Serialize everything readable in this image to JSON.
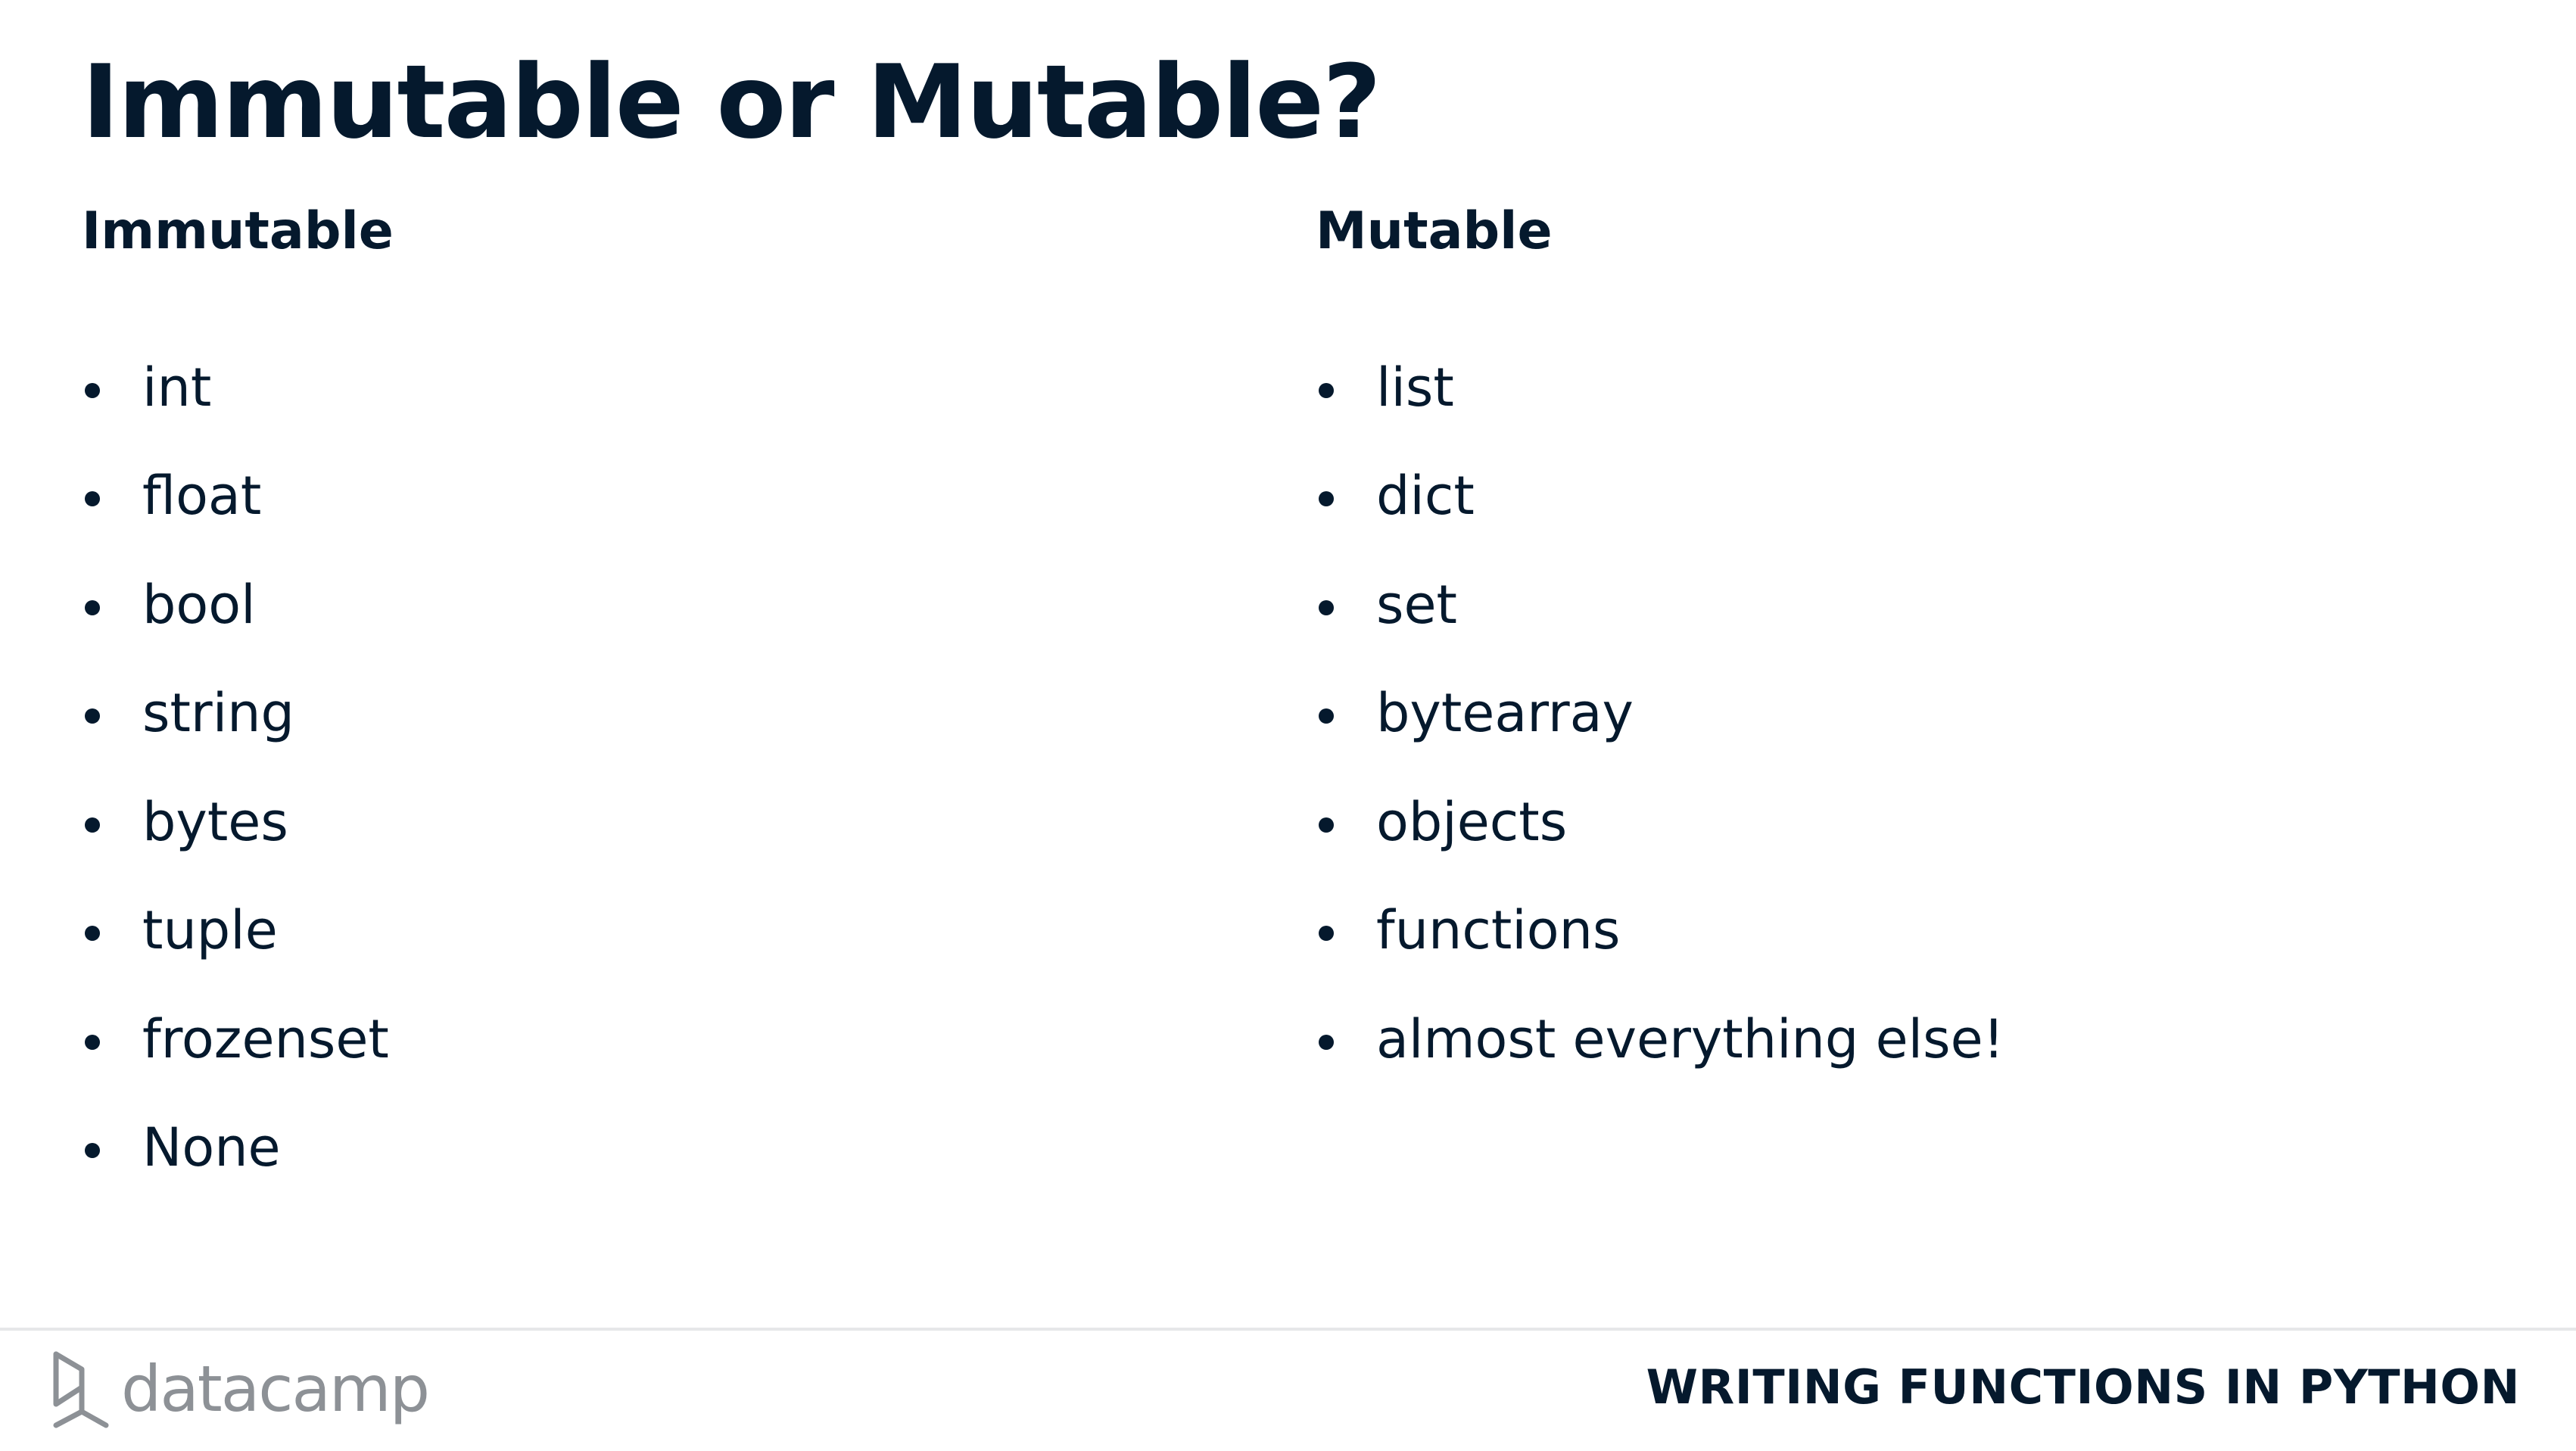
{
  "slide": {
    "title": "Immutable or Mutable?"
  },
  "columns": {
    "immutable": {
      "heading": "Immutable",
      "items": [
        "int",
        "float",
        "bool",
        "string",
        "bytes",
        "tuple",
        "frozenset",
        "None"
      ]
    },
    "mutable": {
      "heading": "Mutable",
      "items": [
        "list",
        "dict",
        "set",
        "bytearray",
        "objects",
        "functions",
        "almost everything else!"
      ]
    }
  },
  "footer": {
    "logo_text": "datacamp",
    "logo_icon": "datacamp-logo-icon",
    "course_title": "WRITING FUNCTIONS IN PYTHON"
  },
  "colors": {
    "text": "#05192d",
    "logo": "#8d9196",
    "divider": "#e6e7e9",
    "background": "#ffffff"
  }
}
